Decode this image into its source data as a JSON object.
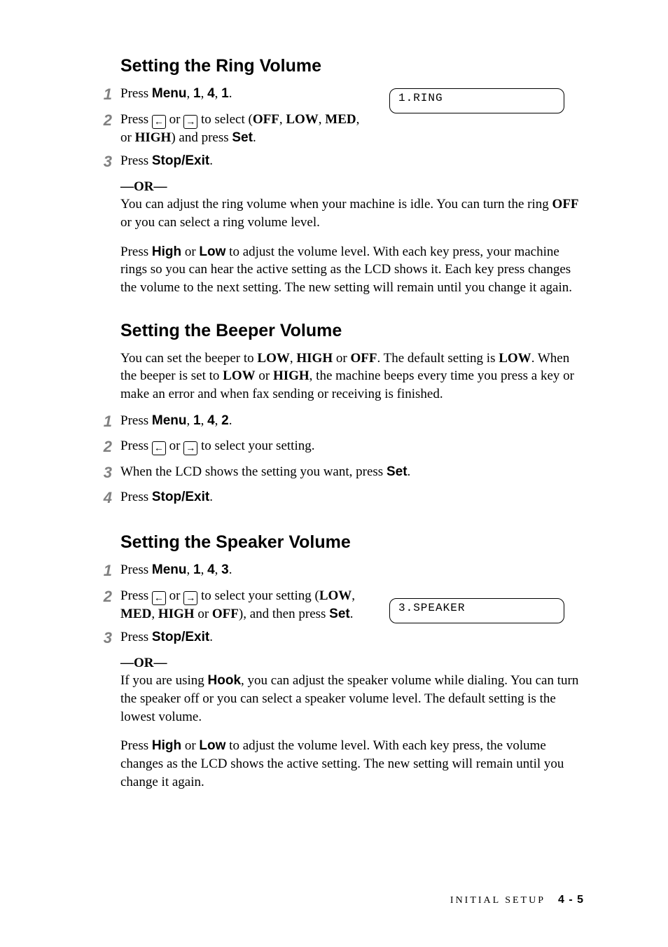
{
  "lcd": {
    "ring": "1.RING",
    "speaker": "3.SPEAKER"
  },
  "ring": {
    "heading": "Setting the Ring Volume",
    "step1_a": "Press ",
    "step1_b": "Menu",
    "step1_c": ", ",
    "step1_d": "1",
    "step1_e": ", ",
    "step1_f": "4",
    "step1_g": ", ",
    "step1_h": "1",
    "step1_i": ".",
    "step2_a": "Press ",
    "step2_b": " or ",
    "step2_c": " to select (",
    "step2_off": "OFF",
    "step2_d": ", ",
    "step2_low": "LOW",
    "step2_e": ", ",
    "step2_med": "MED",
    "step2_f": ", or ",
    "step2_high": "HIGH",
    "step2_g": ") and press ",
    "step2_set": "Set",
    "step2_h": ".",
    "step3_a": "Press ",
    "step3_b": "Stop/Exit",
    "step3_c": ".",
    "or_label": "—OR—",
    "or_text_a": "You can adjust the ring volume when your machine is idle. You can turn the ring ",
    "or_text_b": "OFF",
    "or_text_c": " or you can select a ring volume level.",
    "para2_a": "Press ",
    "para2_high": "High",
    "para2_b": " or ",
    "para2_low": "Low",
    "para2_c": " to adjust the volume level. With each key press, your machine rings so you can hear the active setting as the LCD shows it. Each key press changes the volume to the next setting. The new setting will remain until you change it again."
  },
  "beeper": {
    "heading": "Setting the Beeper Volume",
    "intro_a": "You can set the beeper to ",
    "intro_low1": "LOW",
    "intro_b": ", ",
    "intro_high1": "HIGH",
    "intro_c": " or ",
    "intro_off": "OFF",
    "intro_d": ". The default setting is ",
    "intro_low2": "LOW",
    "intro_e": ". When the beeper is set to ",
    "intro_low3": "LOW",
    "intro_f": " or ",
    "intro_high2": "HIGH",
    "intro_g": ", the machine beeps every time you press a key or make an error and when fax sending or receiving is finished.",
    "step1_a": "Press ",
    "step1_b": "Menu",
    "step1_c": ", ",
    "step1_d": "1",
    "step1_e": ", ",
    "step1_f": "4",
    "step1_g": ", ",
    "step1_h": "2",
    "step1_i": ".",
    "step2_a": "Press ",
    "step2_b": " or ",
    "step2_c": " to select your setting.",
    "step3_a": "When the LCD shows the setting you want, press ",
    "step3_b": "Set",
    "step3_c": ".",
    "step4_a": "Press ",
    "step4_b": "Stop/Exit",
    "step4_c": "."
  },
  "speaker": {
    "heading": "Setting the Speaker Volume",
    "step1_a": "Press ",
    "step1_b": "Menu",
    "step1_c": ", ",
    "step1_d": "1",
    "step1_e": ", ",
    "step1_f": "4",
    "step1_g": ", ",
    "step1_h": "3",
    "step1_i": ".",
    "step2_a": "Press ",
    "step2_b": " or ",
    "step2_c": " to select your setting (",
    "step2_low": "LOW",
    "step2_d": ", ",
    "step2_med": "MED",
    "step2_e": ", ",
    "step2_high": "HIGH",
    "step2_f": " or ",
    "step2_off": "OFF",
    "step2_g": "), and then press ",
    "step2_set": "Set",
    "step2_h": ".",
    "step3_a": "Press ",
    "step3_b": "Stop/Exit",
    "step3_c": ".",
    "or_label": "—OR—",
    "or_text_a": "If you are using ",
    "or_text_b": "Hook",
    "or_text_c": ", you can adjust the speaker volume while dialing. You can turn the speaker off or you can select a speaker volume level. The default setting is the lowest volume.",
    "para2_a": "Press ",
    "para2_high": "High",
    "para2_b": " or ",
    "para2_low": "Low",
    "para2_c": " to adjust the volume level. With each key press, the volume changes as the LCD shows the active setting. The new setting will remain until you change it again."
  },
  "numbers": {
    "n1": "1",
    "n2": "2",
    "n3": "3",
    "n4": "4"
  },
  "footer": {
    "section": "INITIAL SETUP",
    "page": "4 - 5"
  },
  "arrows": {
    "left": "←",
    "right": "→"
  }
}
